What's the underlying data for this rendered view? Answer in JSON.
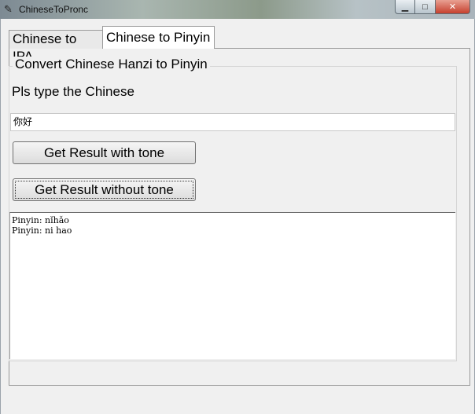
{
  "window": {
    "title": "ChineseToPronc",
    "controls": {
      "minimize": "▭",
      "maximize": "□",
      "close": "✕"
    }
  },
  "tabs": [
    {
      "label": "Chinese to IPA",
      "selected": false
    },
    {
      "label": "Chinese to Pinyin",
      "selected": true
    }
  ],
  "panel": {
    "group_label": "Convert Chinese Hanzi to Pinyin",
    "prompt": "Pls type the Chinese",
    "input_value": "你好",
    "button_with_tone": "Get Result with tone",
    "button_without_tone": "Get Result without tone",
    "output_lines": [
      "Pinyin: nǐhǎo",
      "Pinyin: ni hao"
    ]
  }
}
